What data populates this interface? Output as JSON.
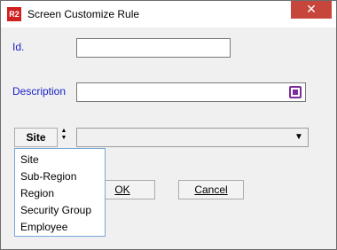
{
  "window": {
    "title": "Screen Customize Rule",
    "app_icon_text": "R2",
    "close_glyph": "✕"
  },
  "form": {
    "id_label": "Id.",
    "id_value": "",
    "description_label": "Description",
    "description_value": ""
  },
  "selector": {
    "selected": "Site",
    "combo_value": "",
    "options": [
      "Site",
      "Sub-Region",
      "Region",
      "Security Group",
      "Employee"
    ]
  },
  "buttons": {
    "ok_label": "OK",
    "cancel_label": "Cancel"
  },
  "icons": {
    "updown": "updown-arrows-icon",
    "combo_arrow": "chevron-down-icon",
    "lookup": "lookup-icon"
  }
}
